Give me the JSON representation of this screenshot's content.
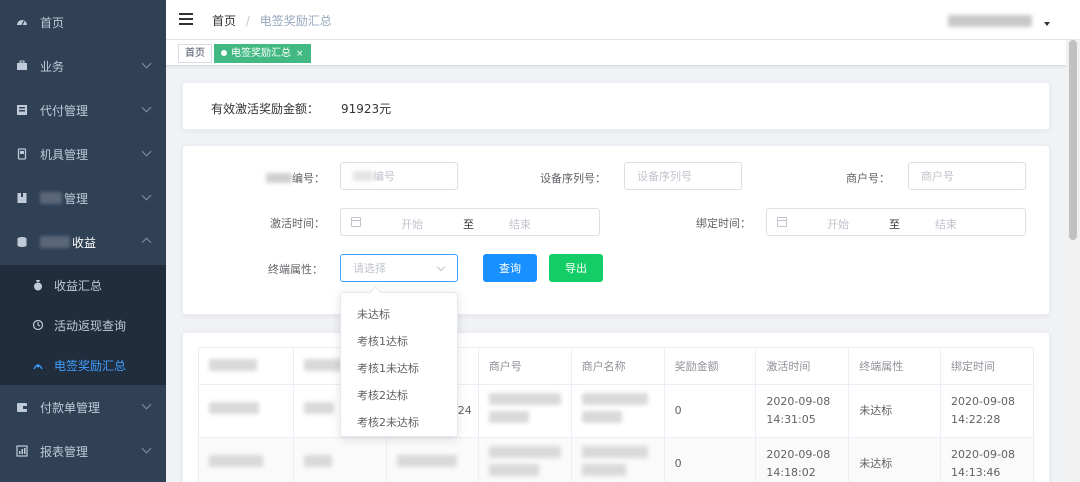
{
  "sidebar": {
    "items": [
      {
        "label": "首页"
      },
      {
        "label": "业务"
      },
      {
        "label": "代付管理"
      },
      {
        "label": "机具管理"
      },
      {
        "label": "管理"
      },
      {
        "label": "收益"
      },
      {
        "label": "付款单管理"
      },
      {
        "label": "报表管理"
      }
    ],
    "submenu": [
      {
        "label": "收益汇总"
      },
      {
        "label": "活动返现查询"
      },
      {
        "label": "电签奖励汇总"
      }
    ]
  },
  "header": {
    "breadcrumb_home": "首页",
    "breadcrumb_sep": "/",
    "breadcrumb_current": "电签奖励汇总"
  },
  "tags": {
    "home": "首页",
    "active": "电签奖励汇总",
    "close": "×"
  },
  "summary": {
    "label": "有效激活奖励金额：",
    "value": "91923元"
  },
  "filters": {
    "code_label": "编号：",
    "code_placeholder": "编号",
    "serial_label": "设备序列号：",
    "serial_placeholder": "设备序列号",
    "merchant_label": "商户号：",
    "merchant_placeholder": "商户号",
    "activate_label": "激活时间：",
    "bind_label": "绑定时间：",
    "range_start": "开始",
    "range_sep": "至",
    "range_end": "结束",
    "terminal_label": "终端属性：",
    "terminal_placeholder": "请选择",
    "query_button": "查询",
    "export_button": "导出"
  },
  "dropdown": {
    "options": [
      "未达标",
      "考核1达标",
      "考核1未达标",
      "考核2达标",
      "考核2未达标"
    ]
  },
  "table": {
    "headers": [
      "",
      "",
      "",
      "商户号",
      "商户名称",
      "奖励金额",
      "激活时间",
      "终端属性",
      "绑定时间"
    ],
    "rows": [
      {
        "partial": "24",
        "amount": "0",
        "activate_time": "2020-09-08 14:31:05",
        "terminal": "未达标",
        "bind_time": "2020-09-08 14:22:28"
      },
      {
        "partial": "",
        "amount": "0",
        "activate_time": "2020-09-08 14:18:02",
        "terminal": "未达标",
        "bind_time": "2020-09-08 14:13:46"
      }
    ]
  }
}
